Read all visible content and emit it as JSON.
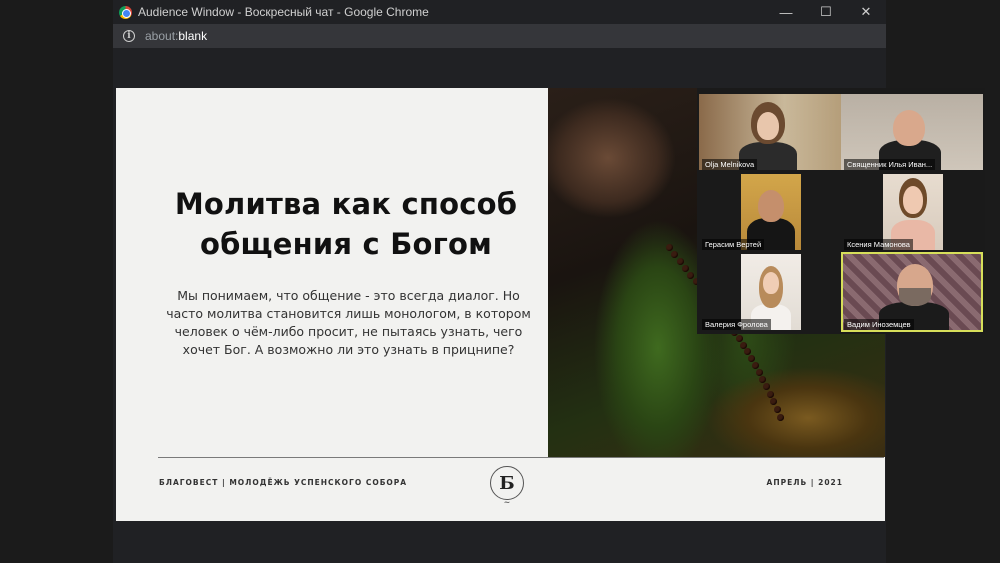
{
  "window": {
    "title": "Audience Window - Воскресный чат - Google Chrome",
    "minimize": "—",
    "maximize": "☐",
    "close": "✕"
  },
  "address": {
    "prefix": "about:",
    "host": "blank"
  },
  "slide": {
    "title": "Молитва как способ общения с Богом",
    "body": "Мы понимаем, что общение - это всегда диалог. Но часто молитва становится лишь монологом, в котором человек о чём-либо просит, не пытаясь узнать, чего хочет Бог. А возможно ли это узнать в прицнипе?",
    "footer_left": "БЛАГОВЕСТ | МОЛОДЁЖЬ УСПЕНСКОГО СОБОРА",
    "footer_right": "АПРЕЛЬ | 2021",
    "logo_letter": "Б"
  },
  "participants": [
    {
      "name": "Olja Melnikova"
    },
    {
      "name": "Священник Илья Иван..."
    },
    {
      "name": "Герасим Вертей"
    },
    {
      "name": "Ксения Мамонова"
    },
    {
      "name": "Валерия Фролова"
    },
    {
      "name": "Вадим Иноземцев",
      "active": true
    }
  ],
  "colors": {
    "active_speaker_border": "#d7df5a",
    "chrome_titlebar": "#202124"
  }
}
